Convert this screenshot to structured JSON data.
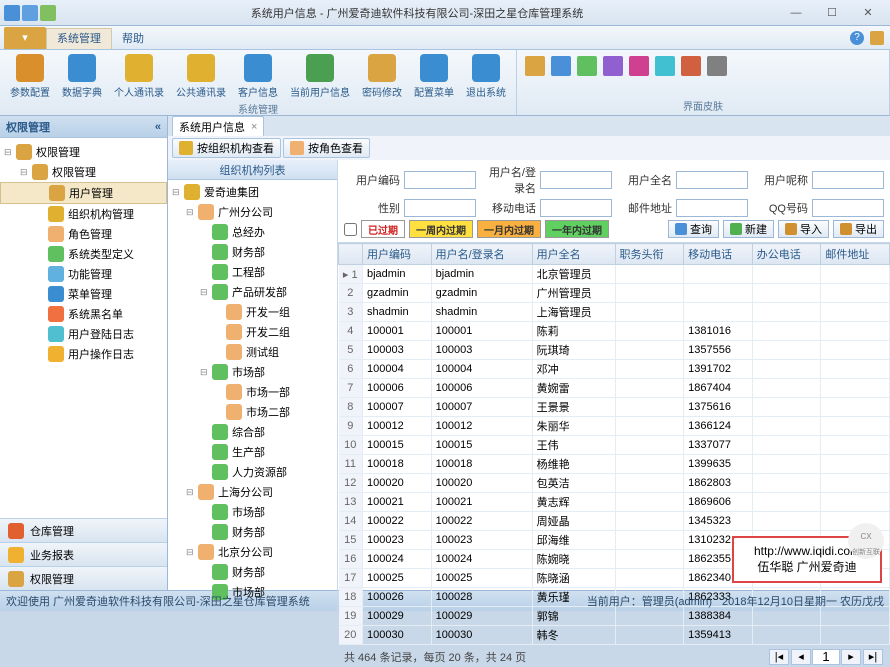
{
  "window": {
    "title": "系统用户信息 - 广州爱奇迪软件科技有限公司-深田之星仓库管理系统"
  },
  "menubar": {
    "file_dropdown": "▾",
    "items": [
      "系统管理",
      "帮助"
    ],
    "active": 0
  },
  "ribbon": {
    "groups": [
      {
        "title": "系统管理",
        "buttons": [
          {
            "label": "参数配置",
            "color": "#d98f2c"
          },
          {
            "label": "数据字典",
            "color": "#3a8dd0"
          },
          {
            "label": "个人通讯录",
            "color": "#e0b030"
          },
          {
            "label": "公共通讯录",
            "color": "#e0b030"
          },
          {
            "label": "客户信息",
            "color": "#3a8dd0"
          },
          {
            "label": "当前用户信息",
            "color": "#4aa050"
          },
          {
            "label": "密码修改",
            "color": "#d9a441"
          },
          {
            "label": "配置菜单",
            "color": "#3a8dd0"
          },
          {
            "label": "退出系统",
            "color": "#3a8dd0"
          }
        ]
      },
      {
        "title": "界面皮肤",
        "icons": 8
      }
    ]
  },
  "left_panel": {
    "header": "权限管理",
    "tree": [
      {
        "label": "权限管理",
        "depth": 0,
        "ico": "#d9a441",
        "exp": "⊟"
      },
      {
        "label": "权限管理",
        "depth": 1,
        "ico": "#d9a441",
        "exp": "⊟"
      },
      {
        "label": "用户管理",
        "depth": 2,
        "ico": "#d9a441",
        "selected": true
      },
      {
        "label": "组织机构管理",
        "depth": 2,
        "ico": "#e0b030"
      },
      {
        "label": "角色管理",
        "depth": 2,
        "ico": "#f0b070"
      },
      {
        "label": "系统类型定义",
        "depth": 2,
        "ico": "#60c060"
      },
      {
        "label": "功能管理",
        "depth": 2,
        "ico": "#60b0e0"
      },
      {
        "label": "菜单管理",
        "depth": 2,
        "ico": "#3a8dd0"
      },
      {
        "label": "系统黑名单",
        "depth": 2,
        "ico": "#f07040"
      },
      {
        "label": "用户登陆日志",
        "depth": 2,
        "ico": "#50c0d0"
      },
      {
        "label": "用户操作日志",
        "depth": 2,
        "ico": "#f0b030"
      }
    ],
    "stack": [
      {
        "label": "仓库管理",
        "color": "#e06030"
      },
      {
        "label": "业务报表",
        "color": "#f0b030"
      },
      {
        "label": "权限管理",
        "color": "#d9a441"
      }
    ]
  },
  "main": {
    "doc_tab": "系统用户信息",
    "sub_tabs": [
      {
        "label": "按组织机构查看",
        "ico": "#e0b030"
      },
      {
        "label": "按角色查看",
        "ico": "#f0b070"
      }
    ],
    "org_header": "组织机构列表",
    "org_tree": [
      {
        "label": "爱奇迪集团",
        "depth": 0,
        "ico": "#e0b030",
        "exp": "⊟"
      },
      {
        "label": "广州分公司",
        "depth": 1,
        "ico": "#f0b070",
        "exp": "⊟"
      },
      {
        "label": "总经办",
        "depth": 2,
        "ico": "#60c060"
      },
      {
        "label": "财务部",
        "depth": 2,
        "ico": "#60c060"
      },
      {
        "label": "工程部",
        "depth": 2,
        "ico": "#60c060"
      },
      {
        "label": "产品研发部",
        "depth": 2,
        "ico": "#60c060",
        "exp": "⊟"
      },
      {
        "label": "开发一组",
        "depth": 3,
        "ico": "#f0b070"
      },
      {
        "label": "开发二组",
        "depth": 3,
        "ico": "#f0b070"
      },
      {
        "label": "测试组",
        "depth": 3,
        "ico": "#f0b070"
      },
      {
        "label": "市场部",
        "depth": 2,
        "ico": "#60c060",
        "exp": "⊟"
      },
      {
        "label": "市场一部",
        "depth": 3,
        "ico": "#f0b070"
      },
      {
        "label": "市场二部",
        "depth": 3,
        "ico": "#f0b070"
      },
      {
        "label": "综合部",
        "depth": 2,
        "ico": "#60c060"
      },
      {
        "label": "生产部",
        "depth": 2,
        "ico": "#60c060"
      },
      {
        "label": "人力资源部",
        "depth": 2,
        "ico": "#60c060"
      },
      {
        "label": "上海分公司",
        "depth": 1,
        "ico": "#f0b070",
        "exp": "⊟"
      },
      {
        "label": "市场部",
        "depth": 2,
        "ico": "#60c060"
      },
      {
        "label": "财务部",
        "depth": 2,
        "ico": "#60c060"
      },
      {
        "label": "北京分公司",
        "depth": 1,
        "ico": "#f0b070",
        "exp": "⊟"
      },
      {
        "label": "财务部",
        "depth": 2,
        "ico": "#60c060"
      },
      {
        "label": "市场部",
        "depth": 2,
        "ico": "#60c060"
      }
    ],
    "filters": {
      "row1": [
        {
          "label": "用户编码",
          "value": ""
        },
        {
          "label": "用户名/登录名",
          "value": ""
        },
        {
          "label": "用户全名",
          "value": ""
        },
        {
          "label": "用户呢称",
          "value": ""
        }
      ],
      "row2": [
        {
          "label": "性别",
          "value": ""
        },
        {
          "label": "移动电话",
          "value": ""
        },
        {
          "label": "邮件地址",
          "value": ""
        },
        {
          "label": "QQ号码",
          "value": ""
        }
      ]
    },
    "legend": [
      {
        "label": "已过期",
        "bg": "#fff",
        "color": "#d02020"
      },
      {
        "label": "一周内过期",
        "bg": "#ffe040",
        "color": "#333"
      },
      {
        "label": "一月内过期",
        "bg": "#f8b040",
        "color": "#333"
      },
      {
        "label": "一年内过期",
        "bg": "#60d060",
        "color": "#333"
      }
    ],
    "actions": [
      {
        "label": "查询",
        "ico": "#4a90d9"
      },
      {
        "label": "新建",
        "ico": "#50b050"
      },
      {
        "label": "导入",
        "ico": "#d09030"
      },
      {
        "label": "导出",
        "ico": "#d09030"
      }
    ],
    "grid": {
      "columns": [
        "",
        "用户编码",
        "用户名/登录名",
        "用户全名",
        "职务头衔",
        "移动电话",
        "办公电话",
        "邮件地址"
      ],
      "rows": [
        {
          "n": 1,
          "cells": [
            "bjadmin",
            "bjadmin",
            "北京管理员",
            "",
            "",
            "",
            ""
          ]
        },
        {
          "n": 2,
          "cells": [
            "gzadmin",
            "gzadmin",
            "广州管理员",
            "",
            "",
            "",
            ""
          ]
        },
        {
          "n": 3,
          "cells": [
            "shadmin",
            "shadmin",
            "上海管理员",
            "",
            "",
            "",
            ""
          ]
        },
        {
          "n": 4,
          "cells": [
            "100001",
            "100001",
            "陈莉",
            "",
            "1381016",
            "",
            ""
          ]
        },
        {
          "n": 5,
          "cells": [
            "100003",
            "100003",
            "阮琪琦",
            "",
            "1357556",
            "",
            ""
          ]
        },
        {
          "n": 6,
          "cells": [
            "100004",
            "100004",
            "邓冲",
            "",
            "1391702",
            "",
            ""
          ]
        },
        {
          "n": 7,
          "cells": [
            "100006",
            "100006",
            "黄婉雷",
            "",
            "1867404",
            "",
            ""
          ]
        },
        {
          "n": 8,
          "cells": [
            "100007",
            "100007",
            "王景景",
            "",
            "1375616",
            "",
            ""
          ]
        },
        {
          "n": 9,
          "cells": [
            "100012",
            "100012",
            "朱丽华",
            "",
            "1366124",
            "",
            ""
          ]
        },
        {
          "n": 10,
          "cells": [
            "100015",
            "100015",
            "王伟",
            "",
            "1337077",
            "",
            ""
          ]
        },
        {
          "n": 11,
          "cells": [
            "100018",
            "100018",
            "杨维艳",
            "",
            "1399635",
            "",
            ""
          ]
        },
        {
          "n": 12,
          "cells": [
            "100020",
            "100020",
            "包英洁",
            "",
            "1862803",
            "",
            ""
          ]
        },
        {
          "n": 13,
          "cells": [
            "100021",
            "100021",
            "黄志辉",
            "",
            "1869606",
            "",
            ""
          ]
        },
        {
          "n": 14,
          "cells": [
            "100022",
            "100022",
            "周娅晶",
            "",
            "1345323",
            "",
            ""
          ]
        },
        {
          "n": 15,
          "cells": [
            "100023",
            "100023",
            "邱海维",
            "",
            "1310232",
            "",
            ""
          ]
        },
        {
          "n": 16,
          "cells": [
            "100024",
            "100024",
            "陈婉晓",
            "",
            "1862355",
            "",
            ""
          ]
        },
        {
          "n": 17,
          "cells": [
            "100025",
            "100025",
            "陈晓涵",
            "",
            "1862340",
            "",
            ""
          ]
        },
        {
          "n": 18,
          "cells": [
            "100026",
            "100028",
            "黄乐瑾",
            "",
            "1862333",
            "",
            ""
          ]
        },
        {
          "n": 19,
          "cells": [
            "100029",
            "100029",
            "郭锦",
            "",
            "1388384",
            "",
            ""
          ]
        },
        {
          "n": 20,
          "cells": [
            "100030",
            "100030",
            "韩冬",
            "",
            "1359413",
            "",
            ""
          ]
        }
      ]
    },
    "pager": {
      "stats": "共 464 条记录，每页 20 条，共 24 页",
      "page": "1"
    }
  },
  "statusbar": {
    "left": "欢迎使用 广州爱奇迪软件科技有限公司-深田之星仓库管理系统",
    "user": "当前用户：管理员(admin)",
    "date": "2018年12月10日星期一 农历戊戌"
  },
  "watermark": {
    "url": "http://www.iqidi.com",
    "name": "伍华聪 广州爱奇迪"
  }
}
